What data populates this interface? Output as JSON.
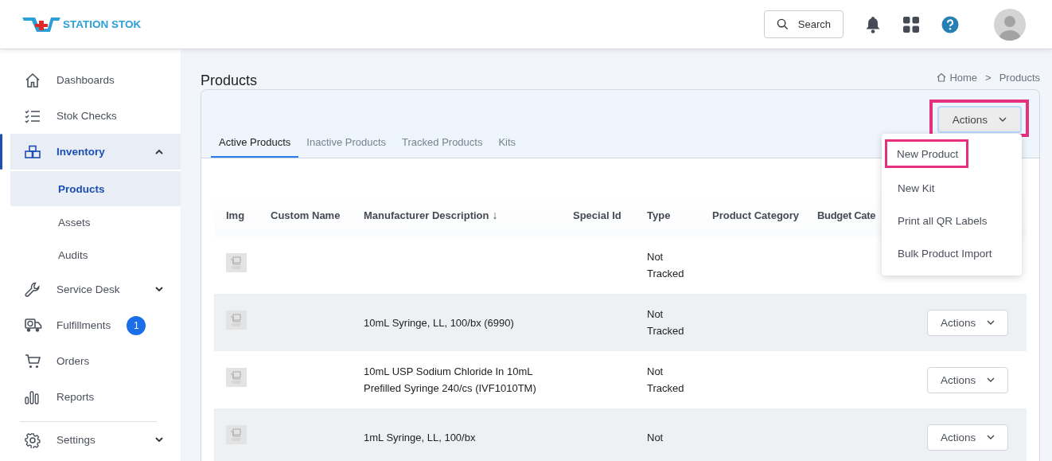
{
  "header": {
    "brand": "STATION STOK",
    "search": {
      "label": "Search"
    }
  },
  "sidebar": {
    "sections": [
      [
        {
          "label": "Dashboards",
          "selected": false
        },
        {
          "label": "Stok Checks",
          "selected": false
        },
        {
          "label": "Inventory",
          "selected": true,
          "expanded": true,
          "children": [
            {
              "label": "Products",
              "selected": true
            },
            {
              "label": "Assets",
              "selected": false
            },
            {
              "label": "Audits",
              "selected": false
            }
          ]
        },
        {
          "label": "Service Desk",
          "selected": false,
          "expanded": false
        },
        {
          "label": "Fulfillments",
          "selected": false,
          "badge": "1"
        },
        {
          "label": "Orders",
          "selected": false
        },
        {
          "label": "Reports",
          "selected": false
        }
      ],
      [
        {
          "label": "Settings",
          "selected": false,
          "expanded": false
        }
      ]
    ]
  },
  "page": {
    "title": "Products",
    "breadcrumb": {
      "items": [
        "Home",
        "Products"
      ],
      "separator": ">"
    }
  },
  "tabs": [
    {
      "label": "Active Products",
      "selected": true
    },
    {
      "label": "Inactive Products",
      "selected": false
    },
    {
      "label": "Tracked Products",
      "selected": false
    },
    {
      "label": "Kits",
      "selected": false
    }
  ],
  "actions_button": {
    "label": "Actions",
    "highlighted": true
  },
  "actions_menu": [
    {
      "label": "New Product",
      "highlighted": true
    },
    {
      "label": "New Kit",
      "highlighted": false
    },
    {
      "label": "Print all QR Labels",
      "highlighted": false
    },
    {
      "label": "Bulk Product Import",
      "highlighted": false
    }
  ],
  "table": {
    "columns": [
      {
        "label": "Img"
      },
      {
        "label": "Custom Name"
      },
      {
        "label": "Manufacturer Description",
        "sort_indicator": "↓"
      },
      {
        "label": "Special Id"
      },
      {
        "label": "Type"
      },
      {
        "label": "Product Category"
      },
      {
        "label": "Budget Cate"
      }
    ],
    "rows": [
      {
        "type": "Not Tracked"
      },
      {
        "description": "10mL Syringe, LL, 100/bx (6990)",
        "type": "Not Tracked",
        "action": "Actions"
      },
      {
        "description": "10mL USP Sodium Chloride In 10mL Prefilled Syringe 240/cs (IVF1010TM)",
        "type": "Not Tracked",
        "action": "Actions"
      },
      {
        "description": "1mL Syringe, LL, 100/bx",
        "type": "Not",
        "action": "Actions"
      }
    ]
  }
}
